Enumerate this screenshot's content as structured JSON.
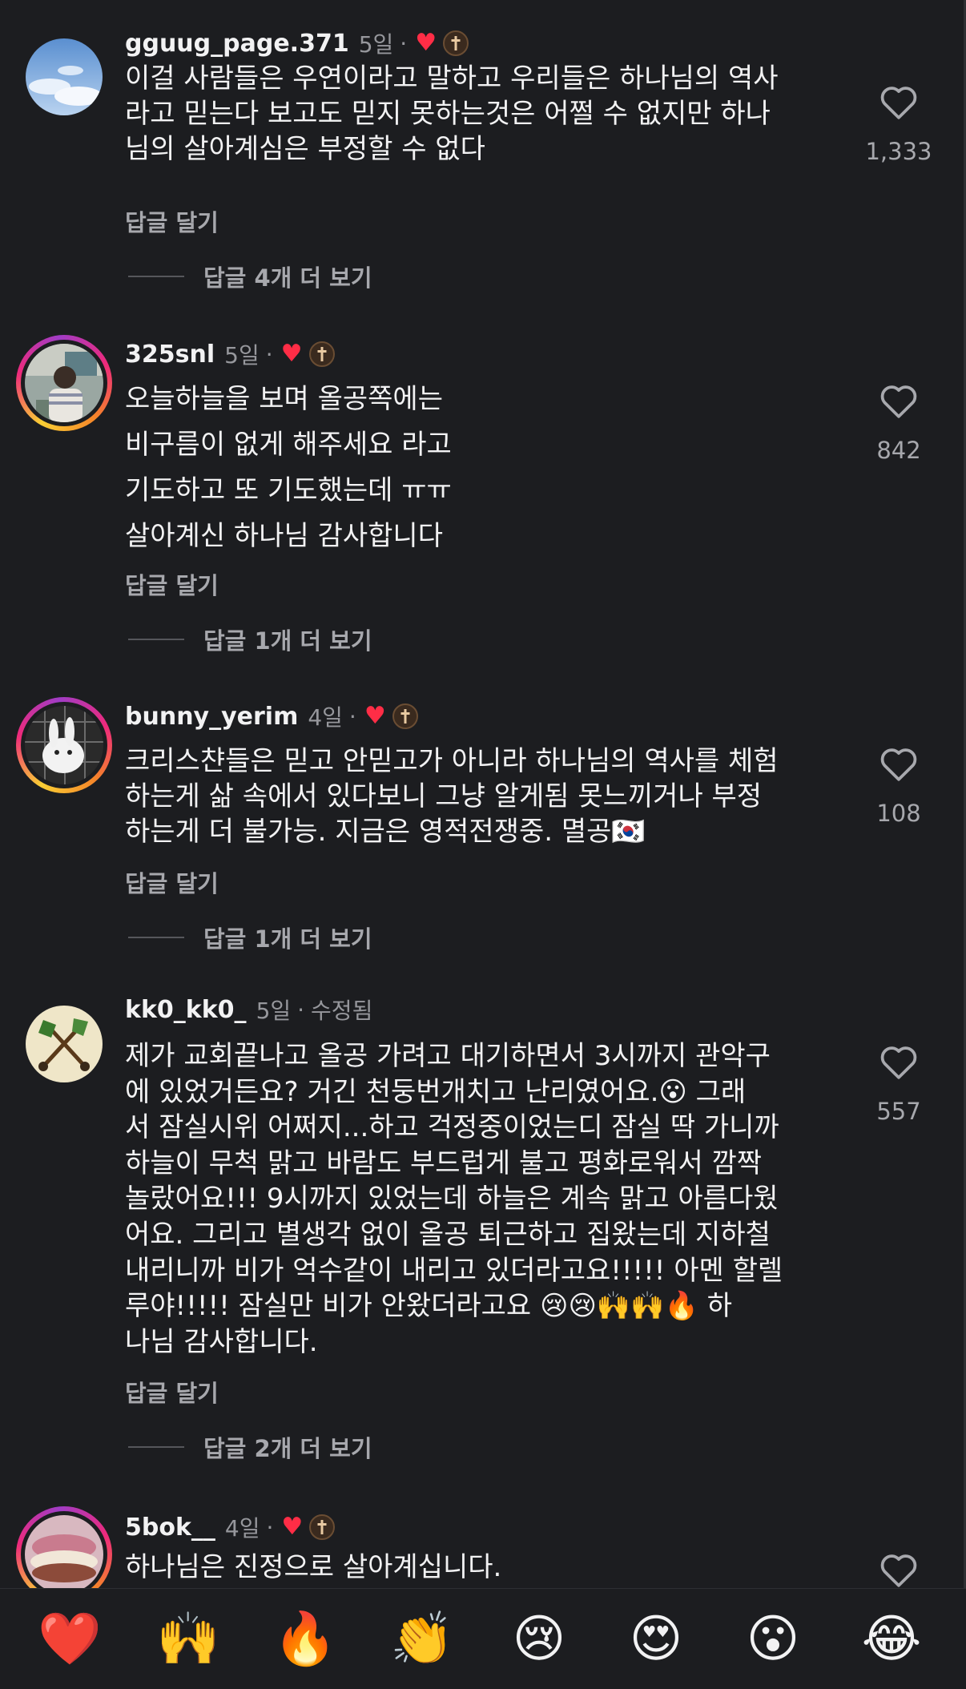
{
  "comments": [
    {
      "username": "gguug_page.371",
      "time": "5일",
      "dot": "·",
      "liked_by_creator": true,
      "text": "이걸 사람들은 우연이라고 말하고 우리들은 하나님의 역사\n라고 믿는다 보고도 믿지 못하는것은 어쩔 수 없지만 하나\n님의 살아계심은 부정할 수 없다",
      "reply_label": "답글 달기",
      "view_replies": "답글 4개 더 보기",
      "likes": "1,333"
    },
    {
      "username": "325snl",
      "time": "5일",
      "dot": "·",
      "liked_by_creator": true,
      "text": "오늘하늘을 보며 올공쪽에는\n비구름이 없게 해주세요 라고\n기도하고 또 기도했는데 ㅠㅠ\n살아계신 하나님 감사합니다",
      "reply_label": "답글 달기",
      "view_replies": "답글 1개 더 보기",
      "likes": "842"
    },
    {
      "username": "bunny_yerim",
      "time": "4일",
      "dot": "·",
      "liked_by_creator": true,
      "text": "크리스챤들은 믿고 안믿고가 아니라 하나님의 역사를 체험\n하는게 삶 속에서 있다보니 그냥 알게됨 못느끼거나 부정\n하는게 더 불가능. 지금은 영적전쟁중. 멸공🇰🇷",
      "reply_label": "답글 달기",
      "view_replies": "답글 1개 더 보기",
      "likes": "108"
    },
    {
      "username": "kk0_kk0_",
      "time": "5일",
      "dot": "·",
      "edited": "수정됨",
      "liked_by_creator": false,
      "text": "제가 교회끝나고 올공 가려고 대기하면서 3시까지 관악구\n에 있었거든요? 거긴 천둥번개치고 난리였어요.😮 그래\n서 잠실시위 어쩌지...하고 걱정중이었는디 잠실 딱 가니까\n하늘이 무척 맑고 바람도 부드럽게 불고 평화로워서 깜짝\n놀랐어요!!! 9시까지 있었는데 하늘은 계속 맑고 아름다웠\n어요. 그리고 별생각 없이 올공 퇴근하고 집왔는데 지하철\n내리니까 비가 억수같이 내리고 있더라고요!!!!! 아멘 할렐\n루야!!!!! 잠실만 비가 안왔더라고요 😢😢🙌🙌🔥 하\n나님 감사합니다.",
      "reply_label": "답글 달기",
      "view_replies": "답글 2개 더 보기",
      "likes": "557"
    },
    {
      "username": "5bok__",
      "time": "4일",
      "dot": "·",
      "liked_by_creator": true,
      "text": "하나님은 진정으로 살아계십니다."
    }
  ],
  "icons": {
    "like": "heart-outline-icon",
    "creator_like": "heart-filled-icon",
    "creator_avatar": "cross-badge-icon"
  },
  "colors": {
    "background": "#1c1d20",
    "secondary_text": "#a7a8ad",
    "heart_red": "#ff2d46"
  },
  "quick_reactions": [
    "❤️",
    "🙌",
    "🔥",
    "👏",
    "😢",
    "😍",
    "😮",
    "😂"
  ]
}
